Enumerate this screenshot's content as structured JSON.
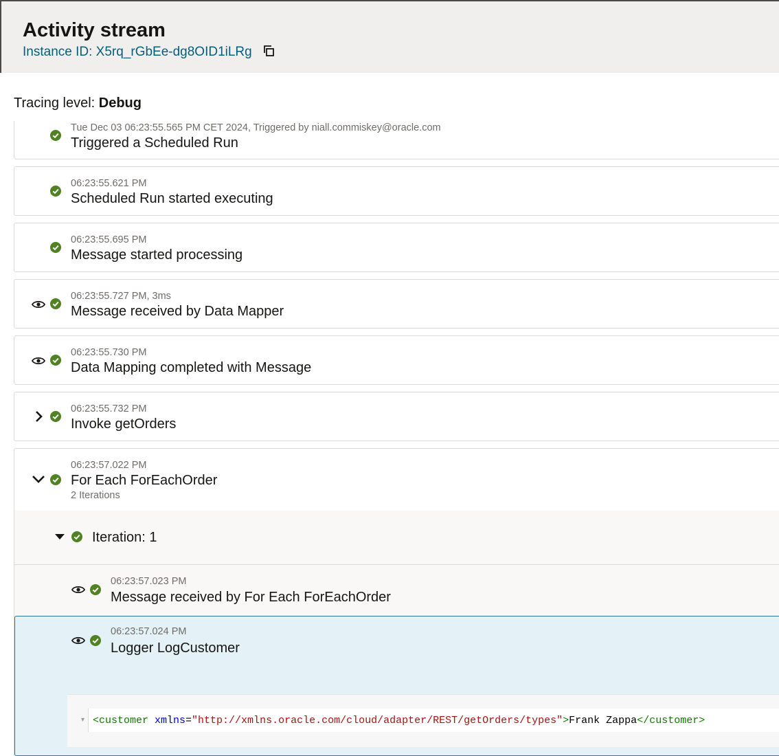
{
  "header": {
    "title": "Activity stream",
    "instance_id": "Instance ID: X5rq_rGbEe-dg8OID1iLRg"
  },
  "tracing": {
    "label": "Tracing level: ",
    "value": "Debug"
  },
  "activities": [
    {
      "timestamp": "Tue Dec 03 06:23:55.565 PM CET 2024, Triggered by niall.commiskey@oracle.com",
      "message": "Triggered a Scheduled Run"
    },
    {
      "timestamp": "06:23:55.621 PM",
      "message": "Scheduled Run started executing"
    },
    {
      "timestamp": "06:23:55.695 PM",
      "message": "Message started processing"
    },
    {
      "timestamp": "06:23:55.727 PM, 3ms",
      "message": "Message received by Data Mapper"
    },
    {
      "timestamp": "06:23:55.730 PM",
      "message": "Data Mapping completed with Message"
    },
    {
      "timestamp": "06:23:55.732 PM",
      "message": "Invoke getOrders"
    },
    {
      "timestamp": "06:23:57.022 PM",
      "message": "For Each ForEachOrder",
      "sub": "2 Iterations"
    }
  ],
  "iteration": {
    "label": "Iteration: 1"
  },
  "iteration_items": [
    {
      "timestamp": "06:23:57.023 PM",
      "message": "Message received by For Each ForEachOrder"
    },
    {
      "timestamp": "06:23:57.024 PM",
      "message": "Logger LogCustomer"
    }
  ],
  "payload": {
    "open_tag": "<customer",
    "attr_name": " xmlns",
    "equals": "=",
    "attr_value": "\"http://xmlns.oracle.com/cloud/adapter/REST/getOrders/types\"",
    "close_bracket": ">",
    "text": "Frank Zappa",
    "end_tag": "</customer>"
  },
  "colors": {
    "success": "#508223",
    "link": "#04607a",
    "selected_bg": "#e4f1f7",
    "selected_border": "#2c7397"
  },
  "icons": [
    "copy-icon",
    "check-circle-icon",
    "eye-icon",
    "chevron-right-icon",
    "chevron-down-icon",
    "caret-down-icon"
  ]
}
